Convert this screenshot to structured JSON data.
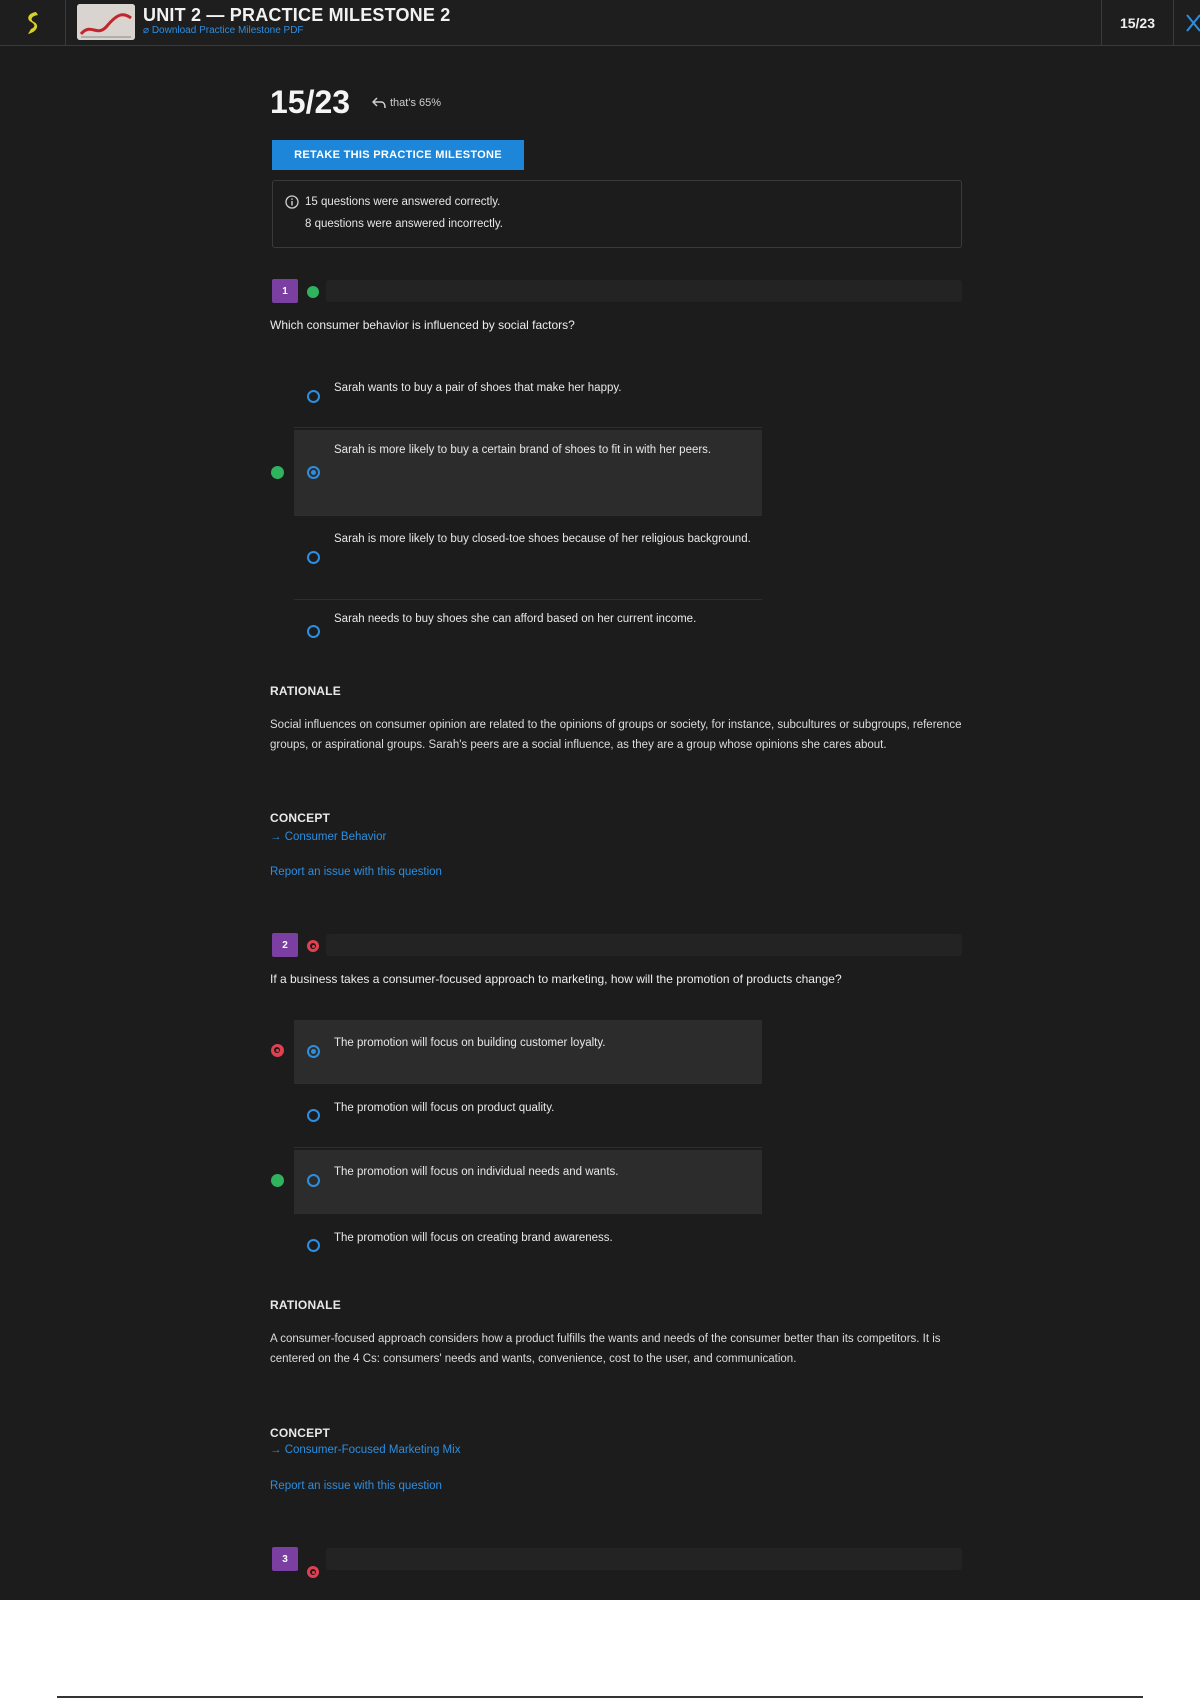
{
  "header": {
    "unit_title": "UNIT 2 — PRACTICE MILESTONE 2",
    "pdf_link": "Download Practice Milestone PDF",
    "score": "15/23"
  },
  "result": {
    "score": "15/23",
    "share_label": "that's 65%",
    "retake_label": "RETAKE THIS PRACTICE MILESTONE",
    "correct_text": "15 questions were answered correctly.",
    "incorrect_text": "8 questions were answered incorrectly."
  },
  "questions": [
    {
      "number": "1",
      "status": "correct",
      "text": "Which consumer behavior is influenced by social factors?",
      "options": [
        {
          "text": "Sarah wants to buy a pair of shoes that make her happy.",
          "selected": false,
          "marker": ""
        },
        {
          "text": "Sarah is more likely to buy a certain brand of shoes to fit in with her peers.",
          "selected": true,
          "marker": "correct"
        },
        {
          "text": "Sarah is more likely to buy closed-toe shoes because of her religious background.",
          "selected": false,
          "marker": ""
        },
        {
          "text": "Sarah needs to buy shoes she can afford based on her current income.",
          "selected": false,
          "marker": ""
        }
      ],
      "rationale_heading": "RATIONALE",
      "rationale": "Social influences on consumer opinion are related to the opinions of groups or society, for instance, subcultures or subgroups, reference groups, or aspirational groups. Sarah's peers are a social influence, as they are a group whose opinions she cares about.",
      "concept_heading": "CONCEPT",
      "concept": "→ Consumer Behavior",
      "report": "Report an issue with this question"
    },
    {
      "number": "2",
      "status": "incorrect",
      "text": "If a business takes a consumer-focused approach to marketing, how will the promotion of products change?",
      "options": [
        {
          "text": "The promotion will focus on building customer loyalty.",
          "selected": true,
          "marker": "incorrect"
        },
        {
          "text": "The promotion will focus on product quality.",
          "selected": false,
          "marker": ""
        },
        {
          "text": "The promotion will focus on individual needs and wants.",
          "selected": false,
          "marker": "correct"
        },
        {
          "text": "The promotion will focus on creating brand awareness.",
          "selected": false,
          "marker": ""
        }
      ],
      "rationale_heading": "RATIONALE",
      "rationale": "A consumer-focused approach considers how a product fulfills the wants and needs of the consumer better than its competitors. It is centered on the 4 Cs: consumers' needs and wants, convenience, cost to the user, and communication.",
      "concept_heading": "CONCEPT",
      "concept": "→ Consumer-Focused Marketing Mix",
      "report": "Report an issue with this question"
    },
    {
      "number": "3",
      "status": "incorrect"
    }
  ],
  "colors": {
    "accent": "#1e86d8",
    "correct": "#2fb35e",
    "incorrect": "#e0404f",
    "question_badge": "#7a3fa0"
  }
}
